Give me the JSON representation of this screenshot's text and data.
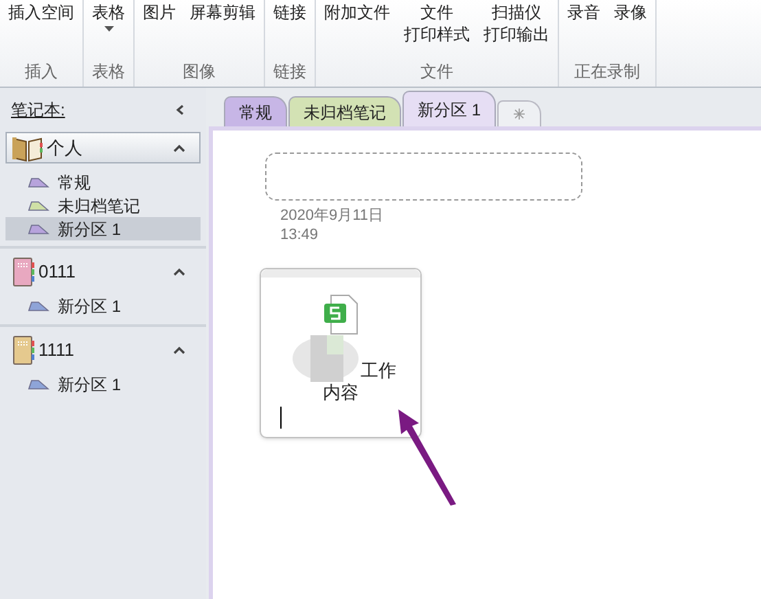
{
  "ribbon": {
    "groups": [
      {
        "label": "插入",
        "buttons": [
          {
            "lines": [
              "插入空间"
            ],
            "dropdown": false
          }
        ]
      },
      {
        "label": "表格",
        "buttons": [
          {
            "lines": [
              "表格"
            ],
            "dropdown": true
          }
        ]
      },
      {
        "label": "图像",
        "buttons": [
          {
            "lines": [
              "图片"
            ],
            "dropdown": false
          },
          {
            "lines": [
              "屏幕剪辑"
            ],
            "dropdown": false
          }
        ]
      },
      {
        "label": "链接",
        "buttons": [
          {
            "lines": [
              "链接"
            ],
            "dropdown": false
          }
        ]
      },
      {
        "label": "文件",
        "buttons": [
          {
            "lines": [
              "附加文件"
            ],
            "dropdown": false
          },
          {
            "lines": [
              "文件",
              "打印样式"
            ],
            "dropdown": false
          },
          {
            "lines": [
              "扫描仪",
              "打印输出"
            ],
            "dropdown": false
          }
        ]
      },
      {
        "label": "正在录制",
        "buttons": [
          {
            "lines": [
              "录音"
            ],
            "dropdown": false
          },
          {
            "lines": [
              "录像"
            ],
            "dropdown": false
          }
        ]
      }
    ]
  },
  "sidebar": {
    "title": "笔记本:",
    "notebooks": [
      {
        "name": "个人",
        "kind": "open",
        "color": "#c9a25a",
        "selected": true,
        "expanded": true,
        "sections": [
          {
            "name": "常规",
            "color": "#b7a3dc",
            "selected": false
          },
          {
            "name": "未归档笔记",
            "color": "#cfe0a6",
            "selected": false
          },
          {
            "name": "新分区 1",
            "color": "#b7a3dc",
            "selected": true
          }
        ]
      },
      {
        "name": "0111",
        "kind": "closed",
        "color": "#e8a8c0",
        "selected": false,
        "expanded": true,
        "sections": [
          {
            "name": "新分区 1",
            "color": "#8ea4d8",
            "selected": false
          }
        ]
      },
      {
        "name": "1111",
        "kind": "closed",
        "color": "#e5c98e",
        "selected": false,
        "expanded": true,
        "sections": [
          {
            "name": "新分区 1",
            "color": "#8ea4d8",
            "selected": false
          }
        ]
      }
    ]
  },
  "tabs": [
    {
      "label": "常规",
      "color": "#c7b6e6",
      "selected": false
    },
    {
      "label": "未归档笔记",
      "color": "#d3e2b4",
      "selected": false
    },
    {
      "label": "新分区 1",
      "color": "#e6def4",
      "selected": true
    }
  ],
  "page": {
    "date": "2020年9月11日",
    "time": "13:49",
    "note": {
      "lines": [
        "工作",
        "内容"
      ]
    }
  }
}
